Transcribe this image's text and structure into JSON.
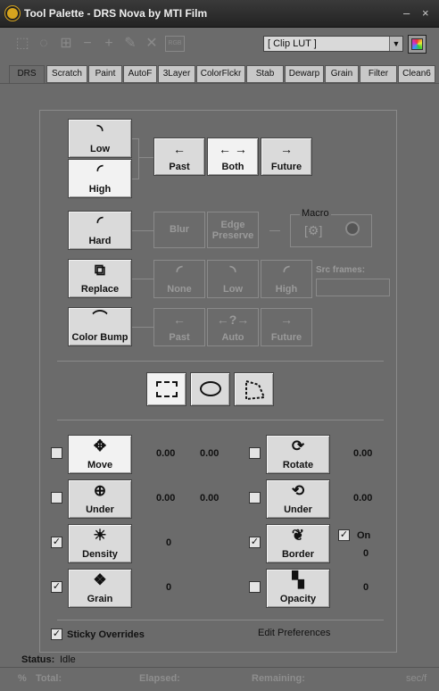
{
  "window": {
    "title": "Tool Palette - DRS Nova by MTI Film",
    "min_glyph": "–",
    "close_glyph": "×"
  },
  "toolbar": {
    "combo_value": "[ Clip LUT ]",
    "text_icon": "RGB",
    "icons": [
      "select-frame-icon",
      "lasso-icon",
      "grid-select-icon",
      "minus-icon",
      "plus-icon",
      "wrench-icon",
      "close-x-icon"
    ]
  },
  "tabs": [
    "DRS",
    "Scratch",
    "Paint",
    "AutoF",
    "3Layer",
    "ColorFlckr",
    "Stab",
    "Dewarp",
    "Grain",
    "Filter",
    "Clean6"
  ],
  "drs": {
    "low": "Low",
    "high": "High",
    "past": "Past",
    "both": "Both",
    "future": "Future",
    "hard": "Hard",
    "blur": "Blur",
    "edge_preserve_1": "Edge",
    "edge_preserve_2": "Preserve",
    "macro": "Macro",
    "replace": "Replace",
    "none": "None",
    "low2": "Low",
    "high2": "High",
    "src_frames": "Src frames:",
    "color_bump": "Color Bump",
    "past2": "Past",
    "auto": "Auto",
    "future2": "Future"
  },
  "overrides": {
    "move": {
      "label": "Move",
      "x": "0.00",
      "y": "0.00",
      "checked": false
    },
    "rotate": {
      "label": "Rotate",
      "value": "0.00",
      "checked": false
    },
    "under1": {
      "label": "Under",
      "x": "0.00",
      "y": "0.00",
      "checked": false
    },
    "under2": {
      "label": "Under",
      "value": "0.00",
      "checked": false
    },
    "density": {
      "label": "Density",
      "value": "0",
      "checked": true
    },
    "border": {
      "label": "Border",
      "value": "0",
      "checked": true
    },
    "border_on": {
      "label": "On",
      "checked": true
    },
    "grain": {
      "label": "Grain",
      "value": "0",
      "checked": true
    },
    "opacity": {
      "label": "Opacity",
      "value": "0",
      "checked": false
    }
  },
  "sticky": {
    "label": "Sticky Overrides",
    "checked": true
  },
  "edit_prefs": "Edit Preferences",
  "status": {
    "label": "Status:",
    "value": "Idle"
  },
  "progress": {
    "percent": "%",
    "total": "Total:",
    "elapsed": "Elapsed:",
    "remaining": "Remaining:",
    "rate": "sec/f"
  },
  "colors": {
    "background": "#6b6b6b",
    "button": "#dadada",
    "title_bar": "#2b2b2b",
    "accent_icon": "#d6a41e"
  }
}
